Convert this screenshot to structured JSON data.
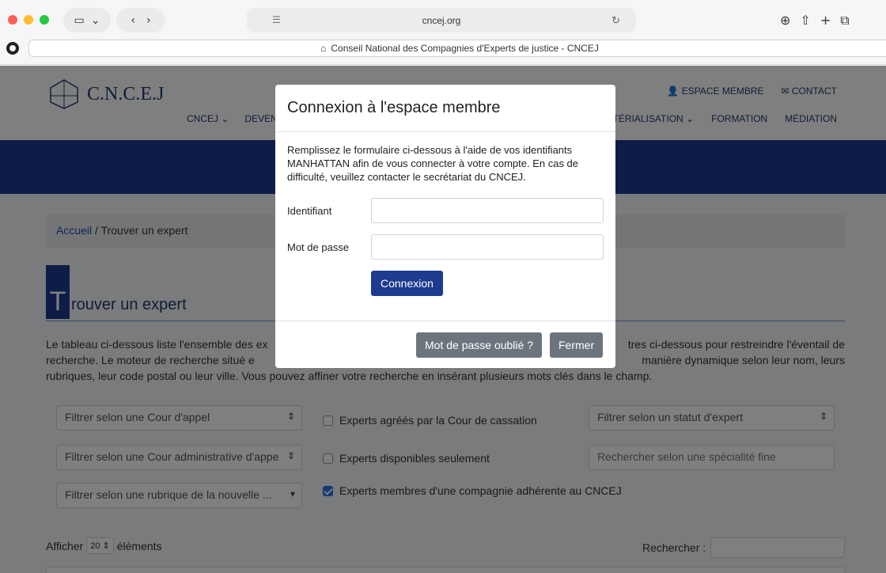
{
  "browser": {
    "url": "cncej.org",
    "tab_title": "Conseil National des Compagnies d'Experts de justice - CNCEJ"
  },
  "site": {
    "logo_text": "C.N.C.E.J",
    "top_links": {
      "member": "ESPACE MEMBRE",
      "contact": "CONTACT"
    },
    "nav": {
      "cncej": "CNCEJ",
      "devenir": "DEVENI",
      "dematerialisation": "ÉMATÉRIALISATION",
      "formation": "FORMATION",
      "mediation": "MÉDIATION"
    },
    "breadcrumb": {
      "home": "Accueil",
      "separator": " / ",
      "current": "Trouver un expert"
    },
    "heading_first_letter": "T",
    "heading_rest": "rouver un expert",
    "intro_left": "Le tableau ci-dessous liste l'ensemble des ex",
    "intro_right": "tres ci-dessous pour restreindre l'éventail de",
    "intro_line2_left": "recherche. Le moteur de recherche situé e",
    "intro_line2_right": "manière dynamique selon leur nom, leurs",
    "intro_line3": "rubriques, leur code postal ou leur ville. Vous pouvez affiner votre recherche en insérant plusieurs mots clés dans le champ.",
    "filters": {
      "cour_appel": "Filtrer selon une Cour d'appel",
      "cour_admin": "Filtrer selon une Cour administrative d'appe",
      "rubrique": "Filtrer selon une rubrique de la nouvelle ...",
      "statut": "Filtrer selon un statut d'expert",
      "specialite_placeholder": "Rechercher selon une spécialité fine",
      "agrees": "Experts agréés par la Cour de cassation",
      "disponibles": "Experts disponibles seulement",
      "membres": "Experts membres d'une compagnie adhérente au CNCEJ"
    },
    "checks": {
      "agrees": false,
      "disponibles": false,
      "membres": true
    },
    "table_controls": {
      "afficher": "Afficher",
      "page_size": "20",
      "elements": "éléments",
      "rechercher": "Rechercher :"
    }
  },
  "modal": {
    "title": "Connexion à l'espace membre",
    "description": "Remplissez le formulaire ci-dessous à l'aide de vos identifiants MANHATTAN afin de vous connecter à votre compte. En cas de difficulté, veuillez contacter le secrétariat du CNCEJ.",
    "identifiant_label": "Identifiant",
    "password_label": "Mot de passe",
    "submit": "Connexion",
    "forgot": "Mot de passe oublié ?",
    "close": "Fermer"
  }
}
